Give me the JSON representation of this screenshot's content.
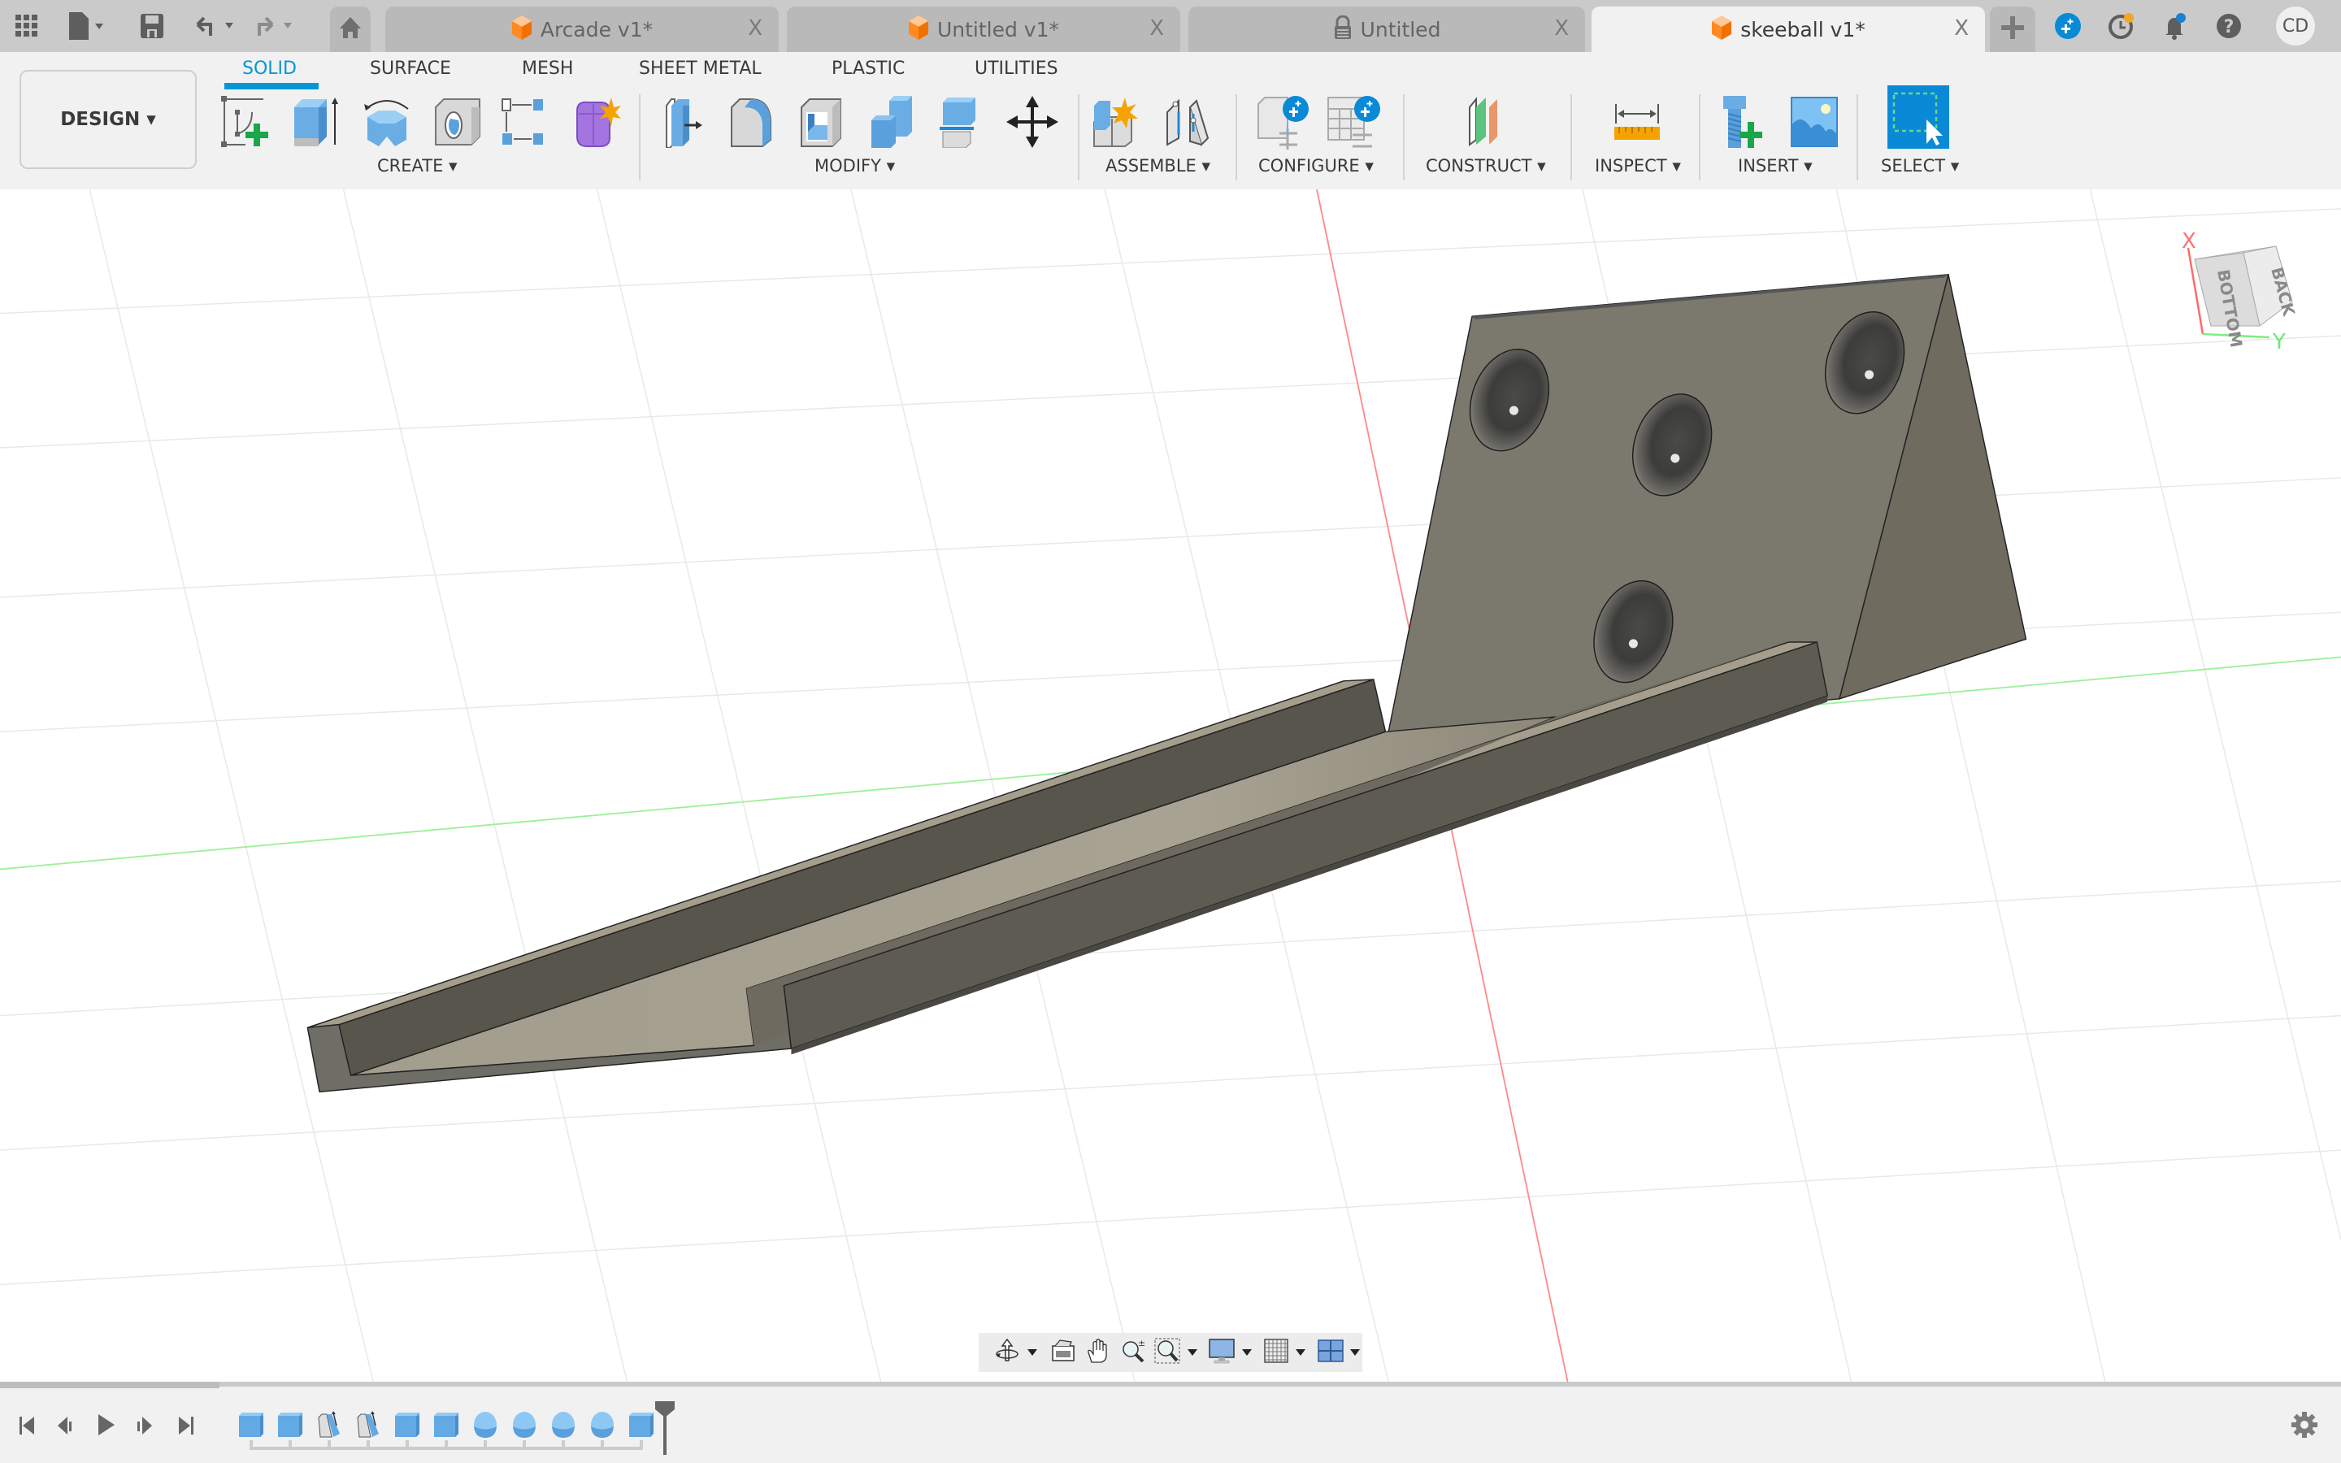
{
  "app": {
    "quick_access": [
      {
        "icon": "grid-icon",
        "label": "Data panel"
      },
      {
        "icon": "file-icon",
        "label": "File"
      },
      {
        "icon": "save-icon",
        "label": "Save"
      },
      {
        "icon": "undo-icon",
        "label": "Undo"
      },
      {
        "icon": "redo-icon",
        "label": "Redo"
      }
    ],
    "home_icon": "home-icon",
    "tabs": [
      {
        "label": "Arcade v1*",
        "icon": "design-cube-icon",
        "active": false,
        "close": "X"
      },
      {
        "label": "Untitled v1*",
        "icon": "design-cube-icon",
        "active": false,
        "close": "X"
      },
      {
        "label": "Untitled",
        "icon": "lock-icon",
        "active": false,
        "close": "X"
      },
      {
        "label": "skeeball v1*",
        "icon": "design-cube-icon",
        "active": true,
        "close": "X"
      }
    ],
    "new_tab_icon": "plus-icon",
    "right_icons": [
      "extensions-icon",
      "job-status-icon",
      "notifications-icon",
      "help-icon"
    ],
    "user_initials": "CD"
  },
  "ribbon": {
    "workspace": "DESIGN ▾",
    "workspace_tabs": [
      {
        "label": "SOLID",
        "active": true
      },
      {
        "label": "SURFACE",
        "active": false
      },
      {
        "label": "MESH",
        "active": false
      },
      {
        "label": "SHEET METAL",
        "active": false
      },
      {
        "label": "PLASTIC",
        "active": false
      },
      {
        "label": "UTILITIES",
        "active": false
      }
    ],
    "groups": [
      {
        "label": "CREATE ▾",
        "tools": [
          "create-sketch",
          "extrude",
          "revolve",
          "hole",
          "pattern",
          "create-form"
        ]
      },
      {
        "label": "MODIFY ▾",
        "tools": [
          "press-pull",
          "fillet",
          "shell",
          "combine",
          "split-body",
          "move-copy"
        ]
      },
      {
        "label": "ASSEMBLE ▾",
        "tools": [
          "new-component",
          "joint"
        ]
      },
      {
        "label": "CONFIGURE ▾",
        "tools": [
          "configure-design",
          "configuration-table"
        ]
      },
      {
        "label": "CONSTRUCT ▾",
        "tools": [
          "offset-plane"
        ]
      },
      {
        "label": "INSPECT ▾",
        "tools": [
          "measure"
        ]
      },
      {
        "label": "INSERT ▾",
        "tools": [
          "insert-mcmaster",
          "insert-canvas"
        ]
      },
      {
        "label": "SELECT ▾",
        "tools": [
          "window-select"
        ]
      }
    ]
  },
  "viewcube": {
    "faces": [
      "BOTTOM",
      "BACK"
    ],
    "axes": {
      "x_label": "X",
      "y_label": "Y"
    }
  },
  "colors": {
    "accent": "#0696d7",
    "tabbar_bg": "#cacaca",
    "ribbon_bg": "#f1f1f1",
    "model_face": "#7a776d",
    "model_top": "#a59e8d",
    "axis_x": "#ff7070",
    "axis_y": "#7cf07c"
  },
  "navbar": {
    "buttons": [
      "orbit-icon",
      "look-at-icon",
      "pan-icon",
      "zoom-icon",
      "fit-icon",
      "display-settings-icon",
      "grid-snaps-icon",
      "viewports-icon"
    ]
  },
  "timeline": {
    "controls": [
      "go-to-start",
      "step-back",
      "play",
      "step-forward",
      "go-to-end"
    ],
    "features": [
      "extrude",
      "extrude",
      "draft",
      "draft",
      "extrude",
      "extrude",
      "sphere",
      "sphere",
      "sphere",
      "sphere",
      "extrude"
    ],
    "settings_icon": "gear-icon"
  }
}
